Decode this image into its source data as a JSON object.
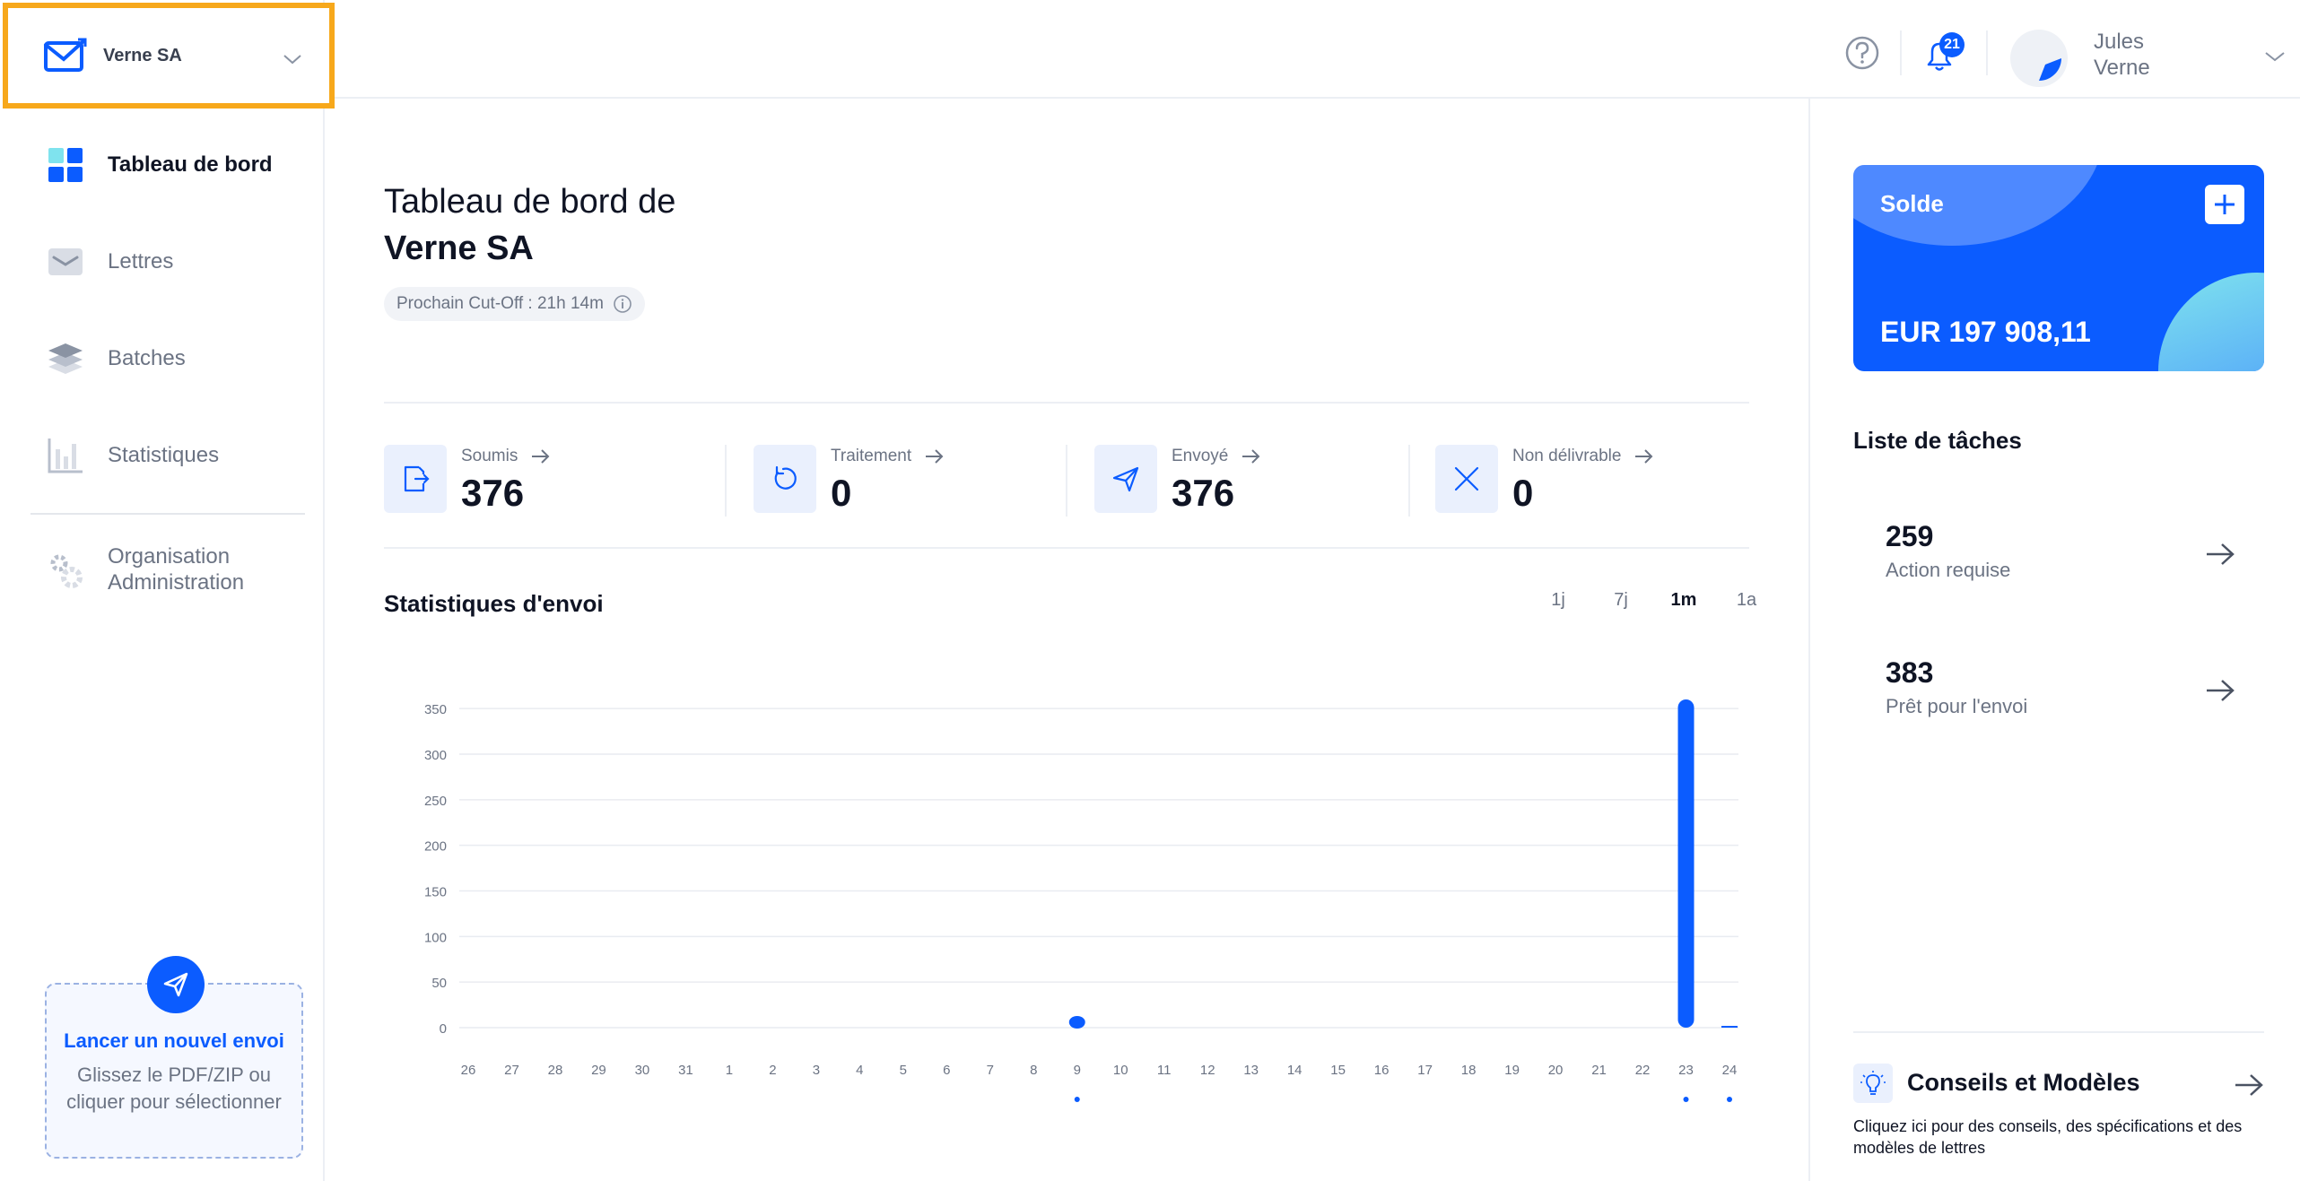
{
  "org": {
    "name": "Verne SA"
  },
  "sidebar": {
    "items": [
      {
        "label": "Tableau de bord",
        "icon": "dashboard-icon",
        "active": true
      },
      {
        "label": "Lettres",
        "icon": "envelope-icon"
      },
      {
        "label": "Batches",
        "icon": "stack-icon"
      },
      {
        "label": "Statistiques",
        "icon": "bar-chart-icon"
      }
    ],
    "org_admin": {
      "line1": "Organisation",
      "line2": "Administration"
    },
    "upload": {
      "title": "Lancer un nouvel envoi",
      "text": "Glissez le PDF/ZIP ou cliquer pour sélectionner"
    }
  },
  "header": {
    "notifications_count": "21",
    "user": {
      "first_name": "Jules",
      "last_name": "Verne"
    }
  },
  "dashboard": {
    "title_prefix": "Tableau de bord de",
    "title_org": "Verne SA",
    "cutoff": "Prochain Cut-Off : 21h 14m",
    "stats": [
      {
        "label": "Soumis",
        "value": "376",
        "icon": "document-export-icon"
      },
      {
        "label": "Traitement",
        "value": "0",
        "icon": "refresh-icon"
      },
      {
        "label": "Envoyé",
        "value": "376",
        "icon": "paper-plane-icon"
      },
      {
        "label": "Non délivrable",
        "value": "0",
        "icon": "x-icon"
      }
    ],
    "chart_title": "Statistiques d'envoi",
    "range_tabs": [
      {
        "label": "1j"
      },
      {
        "label": "7j"
      },
      {
        "label": "1m",
        "active": true
      },
      {
        "label": "1a"
      }
    ]
  },
  "chart_data": {
    "type": "bar",
    "categories": [
      "26",
      "27",
      "28",
      "29",
      "30",
      "31",
      "1",
      "2",
      "3",
      "4",
      "5",
      "6",
      "7",
      "8",
      "9",
      "10",
      "11",
      "12",
      "13",
      "14",
      "15",
      "16",
      "17",
      "18",
      "19",
      "20",
      "21",
      "22",
      "23",
      "24"
    ],
    "values": [
      0,
      0,
      0,
      0,
      0,
      0,
      0,
      0,
      0,
      0,
      0,
      0,
      0,
      0,
      6,
      0,
      0,
      0,
      0,
      0,
      0,
      0,
      0,
      0,
      0,
      0,
      0,
      0,
      360,
      1
    ],
    "markers": [
      "9",
      "23",
      "24"
    ],
    "yticks": [
      0,
      50,
      100,
      150,
      200,
      250,
      300,
      350
    ],
    "ylim": [
      0,
      360
    ],
    "grid": true,
    "color": "#0b5cff"
  },
  "balance": {
    "label": "Solde",
    "value": "EUR 197 908,11"
  },
  "tasks": {
    "title": "Liste de tâches",
    "items": [
      {
        "count": "259",
        "label": "Action requise",
        "bg": "#fdf3ec"
      },
      {
        "count": "383",
        "label": "Prêt pour l'envoi",
        "bg": "#eef5f0"
      }
    ]
  },
  "tips": {
    "title": "Conseils et Modèles",
    "text": "Cliquez ici pour des conseils, des spécifications et des modèles de lettres"
  },
  "colors": {
    "accent": "#0b5cff",
    "highlight": "#f7a81b"
  }
}
